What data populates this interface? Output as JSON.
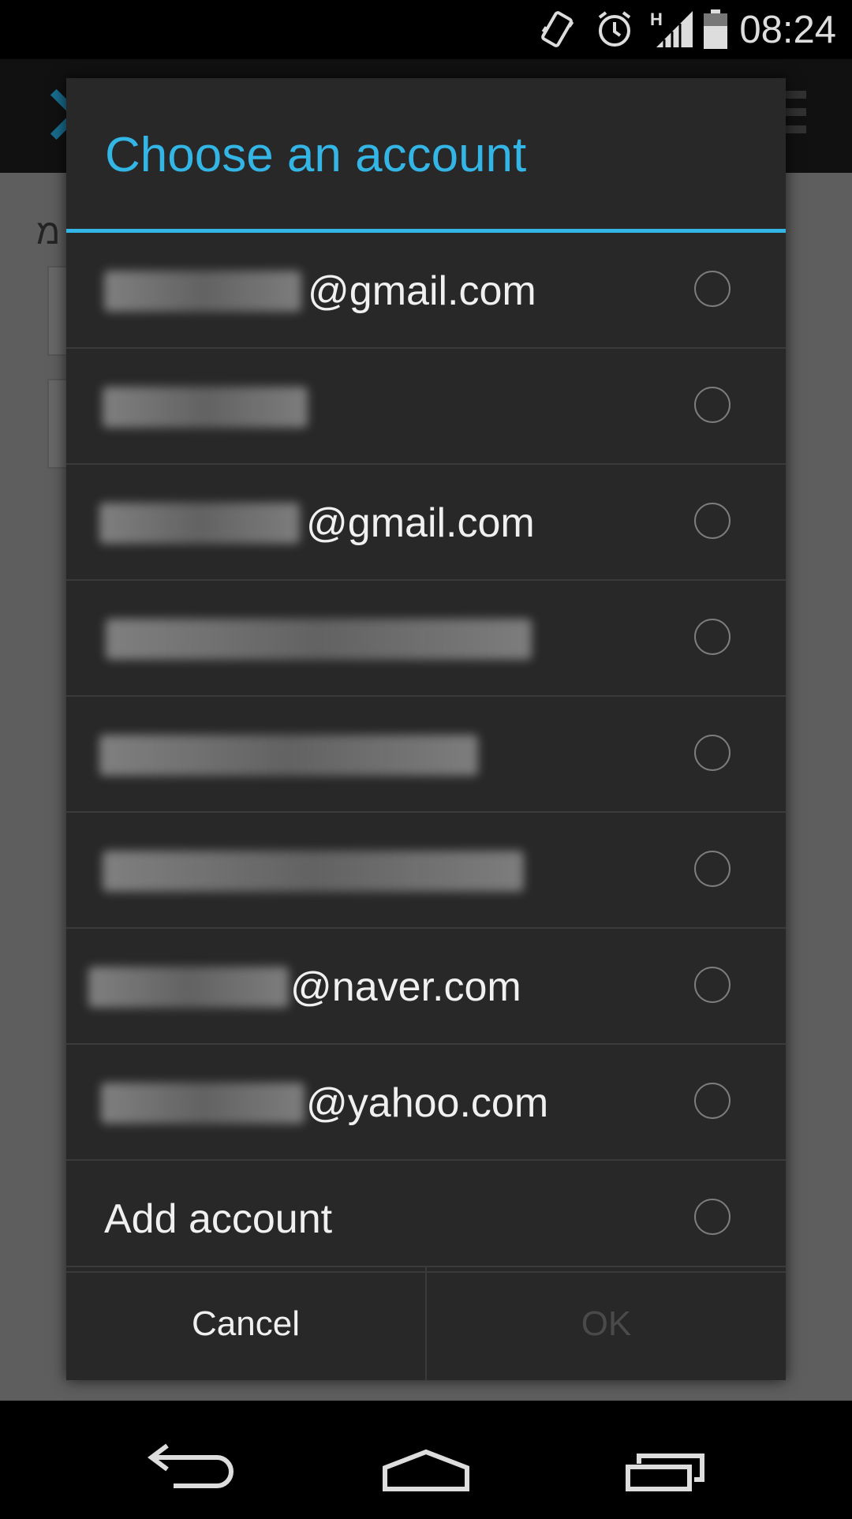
{
  "status_bar": {
    "time": "08:24",
    "network_label": "H",
    "icons": [
      "vibrate-icon",
      "alarm-icon",
      "signal-icon",
      "battery-icon"
    ]
  },
  "background_app": {
    "close_icon": "close-icon",
    "rtl_text": "מ"
  },
  "dialog": {
    "title": "Choose an account",
    "accent_color": "#33b5e5",
    "accounts": [
      {
        "suffix": "@gmail.com"
      },
      {
        "suffix": ""
      },
      {
        "suffix": "@gmail.com"
      },
      {
        "suffix": ""
      },
      {
        "suffix": ""
      },
      {
        "suffix": ""
      },
      {
        "suffix": "@naver.com"
      },
      {
        "suffix": "@yahoo.com"
      }
    ],
    "add_account_label": "Add account",
    "cancel_label": "Cancel",
    "ok_label": "OK"
  },
  "nav_bar": {
    "icons": [
      "back-icon",
      "home-icon",
      "recent-apps-icon"
    ]
  }
}
